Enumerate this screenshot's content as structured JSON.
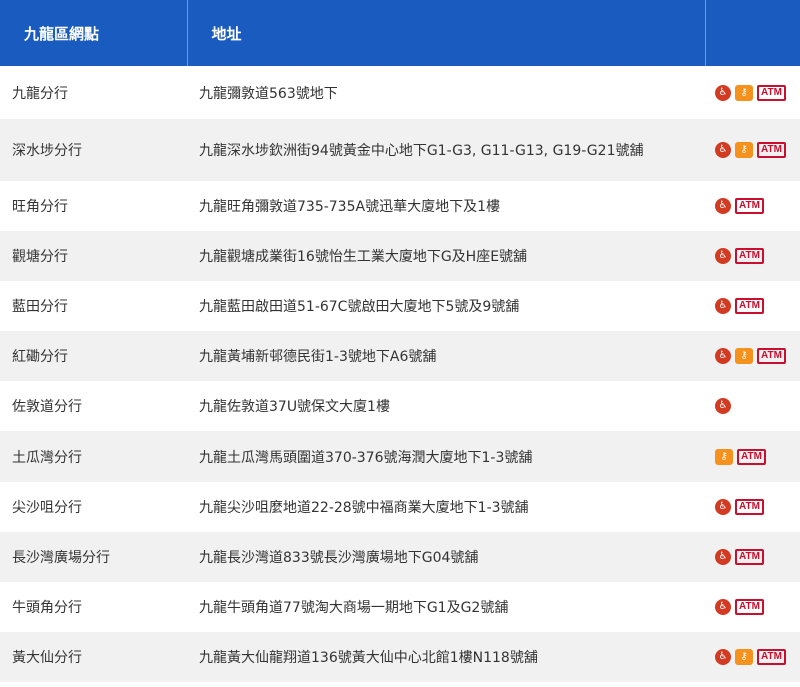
{
  "header": {
    "col_name": "九龍區網點",
    "col_address": "地址",
    "col_services": ""
  },
  "icons": {
    "wheelchair": "wheelchair-access-icon",
    "key": "safe-deposit-box-icon",
    "atm": "ATM"
  },
  "colors": {
    "header_bg": "#1a5bbf",
    "row_alt_bg": "#f1f1f1",
    "wheelchair_icon": "#d33a22",
    "key_icon": "#f5921e",
    "atm_icon": "#c8102e"
  },
  "rows": [
    {
      "name": "九龍分行",
      "address": "九龍彌敦道563號地下",
      "wheelchair": true,
      "key": true,
      "atm": true
    },
    {
      "name": "深水埗分行",
      "address": "九龍深水埗欽洲街94號黃金中心地下G1-G3, G11-G13, G19-G21號舖",
      "wheelchair": true,
      "key": true,
      "atm": true
    },
    {
      "name": "旺角分行",
      "address": "九龍旺角彌敦道735-735A號迅華大廈地下及1樓",
      "wheelchair": true,
      "key": false,
      "atm": true
    },
    {
      "name": "觀塘分行",
      "address": "九龍觀塘成業街16號怡生工業大廈地下G及H座E號舖",
      "wheelchair": true,
      "key": false,
      "atm": true
    },
    {
      "name": "藍田分行",
      "address": "九龍藍田啟田道51-67C號啟田大廈地下5號及9號舖",
      "wheelchair": true,
      "key": false,
      "atm": true
    },
    {
      "name": "紅磡分行",
      "address": "九龍黃埔新邨德民街1-3號地下A6號舖",
      "wheelchair": true,
      "key": true,
      "atm": true
    },
    {
      "name": "佐敦道分行",
      "address": "九龍佐敦道37U號保文大廈1樓",
      "wheelchair": true,
      "key": false,
      "atm": false
    },
    {
      "name": "土瓜灣分行",
      "address": "九龍土瓜灣馬頭圍道370-376號海潤大廈地下1-3號舖",
      "wheelchair": false,
      "key": true,
      "atm": true
    },
    {
      "name": "尖沙咀分行",
      "address": "九龍尖沙咀麼地道22-28號中福商業大廈地下1-3號舖",
      "wheelchair": true,
      "key": false,
      "atm": true
    },
    {
      "name": "長沙灣廣場分行",
      "address": "九龍長沙灣道833號長沙灣廣場地下G04號舖",
      "wheelchair": true,
      "key": false,
      "atm": true
    },
    {
      "name": "牛頭角分行",
      "address": "九龍牛頭角道77號淘大商場一期地下G1及G2號舖",
      "wheelchair": true,
      "key": false,
      "atm": true
    },
    {
      "name": "黃大仙分行",
      "address": "九龍黃大仙龍翔道136號黃大仙中心北館1樓N118號舖",
      "wheelchair": true,
      "key": true,
      "atm": true
    }
  ]
}
